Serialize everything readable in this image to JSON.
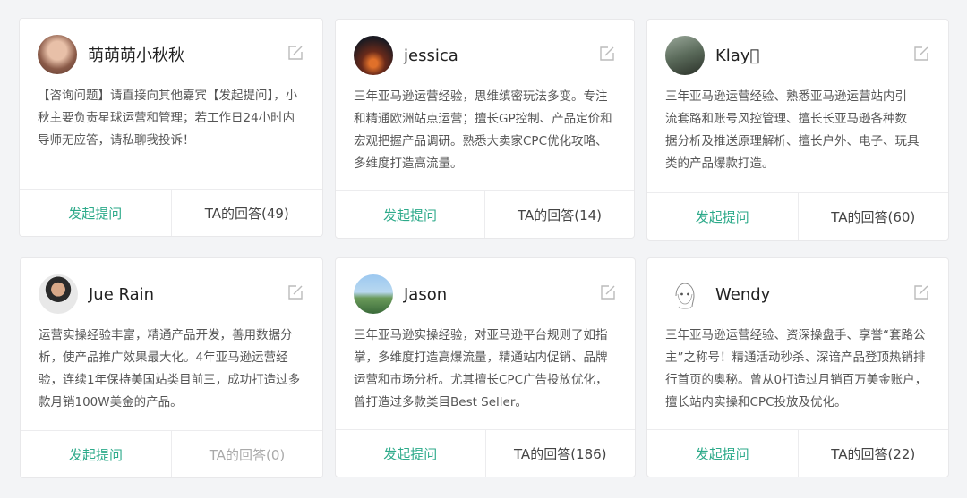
{
  "colors": {
    "background": "#f3f4f6",
    "card": "#ffffff",
    "accent": "#2daa8a",
    "muted": "#aaaaaa"
  },
  "cards": [
    {
      "name": "萌萌萌小秋秋",
      "avatar": "avatar-photo",
      "description": "【咨询问题】请直接向其他嘉宾【发起提问】，小\n秋主要负责星球运营和管理；若工作日24小时内\n导师无应答，请私聊我投诉！",
      "ask_label": "发起提问",
      "answers_label": "TA的回答(49)"
    },
    {
      "name": "jessica",
      "avatar": "avatar-photo",
      "description": "三年亚马逊运营经验，思维缜密玩法多变。专注\n和精通欧洲站点运营；擅长GP控制、产品定价和\n宏观把握产品调研。熟悉大卖家CPC优化攻略、\n多维度打造高流量。",
      "ask_label": "发起提问",
      "answers_label": "TA的回答(14)"
    },
    {
      "name": "Klay\u0000",
      "avatar": "avatar-photo",
      "description": "三年亚马逊运营经验、熟悉亚马逊运营站内引\n流套路和账号风控管理、擅长长亚马逊各种数\n据分析及推送原理解析、擅长户外、电子、玩具\n类的产品爆款打造。",
      "ask_label": "发起提问",
      "answers_label": "TA的回答(60)"
    },
    {
      "name": "Jue Rain",
      "avatar": "avatar-photo",
      "description": "运营实操经验丰富，精通产品开发，善用数据分\n析，使产品推广效果最大化。4年亚马逊运营经\n验，连续1年保持美国站类目前三，成功打造过多\n款月销100W美金的产品。",
      "ask_label": "发起提问",
      "answers_label": "TA的回答(0)"
    },
    {
      "name": "Jason",
      "avatar": "avatar-photo",
      "description": "三年亚马逊实操经验，对亚马逊平台规则了如指\n掌，多维度打造高爆流量，精通站内促销、品牌\n运营和市场分析。尤其擅长CPC广告投放优化，\n曾打造过多款类目Best Seller。",
      "ask_label": "发起提问",
      "answers_label": "TA的回答(186)"
    },
    {
      "name": "Wendy",
      "avatar": "avatar-sketch",
      "description": "三年亚马逊运营经验、资深操盘手、享誉“套路公\n主”之称号！精通活动秒杀、深谙产品登顶热销排\n行首页的奥秘。曾从0打造过月销百万美金账户，\n擅长站内实操和CPC投放及优化。",
      "ask_label": "发起提问",
      "answers_label": "TA的回答(22)"
    }
  ]
}
